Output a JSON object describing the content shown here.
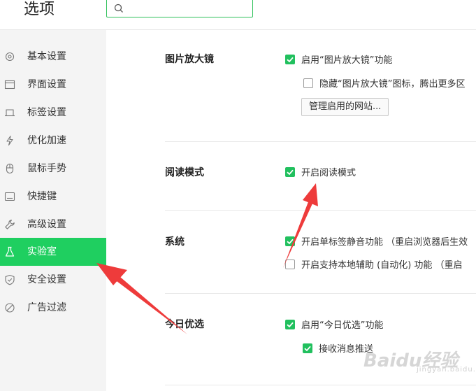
{
  "header": {
    "title": "选项",
    "search_placeholder": ""
  },
  "sidebar": {
    "items": [
      {
        "label": "基本设置",
        "icon": "gear-icon"
      },
      {
        "label": "界面设置",
        "icon": "window-icon"
      },
      {
        "label": "标签设置",
        "icon": "tab-icon"
      },
      {
        "label": "优化加速",
        "icon": "lightning-icon"
      },
      {
        "label": "鼠标手势",
        "icon": "mouse-icon"
      },
      {
        "label": "快捷键",
        "icon": "keyboard-icon"
      },
      {
        "label": "高级设置",
        "icon": "wrench-icon"
      },
      {
        "label": "实验室",
        "icon": "flask-icon",
        "active": true
      },
      {
        "label": "安全设置",
        "icon": "shield-icon"
      },
      {
        "label": "广告过滤",
        "icon": "block-icon"
      }
    ]
  },
  "sections": {
    "magnifier": {
      "title": "图片放大镜",
      "opt1": "启用“图片放大镜”功能",
      "opt2": "隐藏“图片放大镜”图标，腾出更多区",
      "button": "管理启用的网站..."
    },
    "reading": {
      "title": "阅读模式",
      "opt1": "开启阅读模式"
    },
    "system": {
      "title": "系统",
      "opt1": "开启单标签静音功能 （重启浏览器后生效",
      "opt2": "开启支持本地辅助 (自动化) 功能 （重启"
    },
    "today": {
      "title": "今日优选",
      "opt1": "启用“今日优选”功能",
      "opt2": "接收消息推送"
    }
  },
  "watermark": {
    "brand": "Baidu经验",
    "sub": "jingyan.baidu.com"
  },
  "colors": {
    "accent": "#1fcf60",
    "checkbox": "#21c05e",
    "annotation_arrow": "#ee3b3b"
  }
}
